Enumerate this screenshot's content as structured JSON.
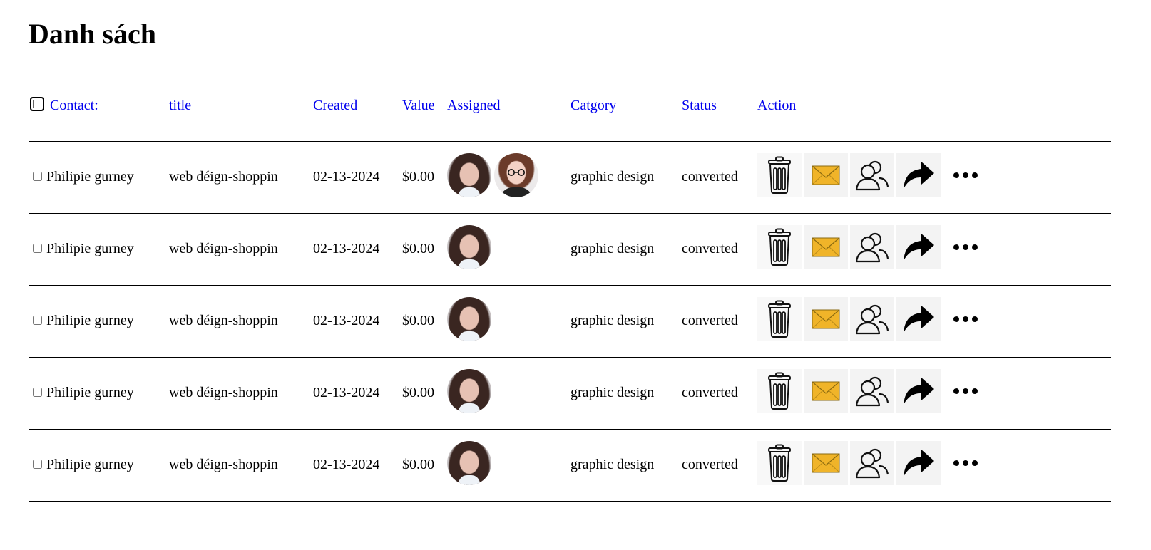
{
  "page": {
    "title": "Danh sách"
  },
  "table": {
    "headers": {
      "contact": "Contact:",
      "title": "title",
      "created": "Created",
      "value": "Value",
      "assigned": "Assigned",
      "category": "Catgory",
      "status": "Status",
      "action": "Action"
    },
    "rows": [
      {
        "contact": "Philipie gurney",
        "title": "web déign-shoppin",
        "created": "02-13-2024",
        "value": "$0.00",
        "category": "graphic design",
        "status": "converted",
        "assignees": 2
      },
      {
        "contact": "Philipie gurney",
        "title": "web déign-shoppin",
        "created": "02-13-2024",
        "value": "$0.00",
        "category": "graphic design",
        "status": "converted",
        "assignees": 1
      },
      {
        "contact": "Philipie gurney",
        "title": "web déign-shoppin",
        "created": "02-13-2024",
        "value": "$0.00",
        "category": "graphic design",
        "status": "converted",
        "assignees": 1
      },
      {
        "contact": "Philipie gurney",
        "title": "web déign-shoppin",
        "created": "02-13-2024",
        "value": "$0.00",
        "category": "graphic design",
        "status": "converted",
        "assignees": 1
      },
      {
        "contact": "Philipie gurney",
        "title": "web déign-shoppin",
        "created": "02-13-2024",
        "value": "$0.00",
        "category": "graphic design",
        "status": "converted",
        "assignees": 1
      }
    ],
    "actions": [
      "trash-icon",
      "mail-icon",
      "users-icon",
      "share-icon",
      "more-icon"
    ]
  },
  "colors": {
    "link": "#0000ee",
    "mail_fill": "#f0b429",
    "action_bg": "#f3f3f3"
  }
}
